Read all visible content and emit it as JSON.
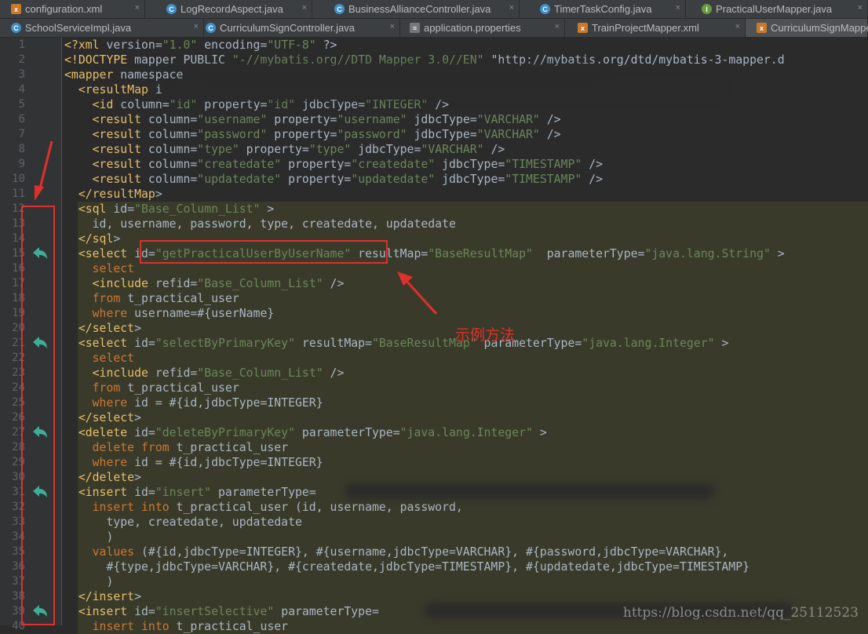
{
  "tabs_row1": [
    {
      "label": "configuration.xml",
      "icon": "xml-file-icon",
      "type": "x"
    },
    {
      "label": "LogRecordAspect.java",
      "icon": "class-icon",
      "type": "c"
    },
    {
      "label": "BusinessAllianceController.java",
      "icon": "class-icon",
      "type": "c"
    },
    {
      "label": "TimerTaskConfig.java",
      "icon": "class-icon",
      "type": "c"
    },
    {
      "label": "PracticalUserMapper.java",
      "icon": "interface-icon",
      "type": "i"
    }
  ],
  "tabs_row2": [
    {
      "label": "SchoolServiceImpl.java",
      "icon": "class-icon",
      "type": "c"
    },
    {
      "label": "CurriculumSignController.java",
      "icon": "class-icon",
      "type": "c"
    },
    {
      "label": "application.properties",
      "icon": "properties-file-icon",
      "type": "p"
    },
    {
      "label": "TrainProjectMapper.xml",
      "icon": "xml-file-icon",
      "type": "x"
    },
    {
      "label": "CurriculumSignMappe",
      "icon": "xml-file-icon",
      "type": "x"
    }
  ],
  "lines": [
    {
      "n": "1",
      "code": "<?xml version=\"1.0\" encoding=\"UTF-8\" ?>"
    },
    {
      "n": "2",
      "code": "<!DOCTYPE mapper PUBLIC \"-//mybatis.org//DTD Mapper 3.0//EN\" \"http://mybatis.org/dtd/mybatis-3-mapper.d"
    },
    {
      "n": "3",
      "code": "<mapper namespace"
    },
    {
      "n": "4",
      "code": "  <resultMap i"
    },
    {
      "n": "5",
      "code": "    <id column=\"id\" property=\"id\" jdbcType=\"INTEGER\" />"
    },
    {
      "n": "6",
      "code": "    <result column=\"username\" property=\"username\" jdbcType=\"VARCHAR\" />"
    },
    {
      "n": "7",
      "code": "    <result column=\"password\" property=\"password\" jdbcType=\"VARCHAR\" />"
    },
    {
      "n": "8",
      "code": "    <result column=\"type\" property=\"type\" jdbcType=\"VARCHAR\" />"
    },
    {
      "n": "9",
      "code": "    <result column=\"createdate\" property=\"createdate\" jdbcType=\"TIMESTAMP\" />"
    },
    {
      "n": "10",
      "code": "    <result column=\"updatedate\" property=\"updatedate\" jdbcType=\"TIMESTAMP\" />"
    },
    {
      "n": "11",
      "code": "  </resultMap>"
    },
    {
      "n": "12",
      "code": "  <sql id=\"Base_Column_List\" >"
    },
    {
      "n": "13",
      "code": "    id, username, password, type, createdate, updatedate"
    },
    {
      "n": "14",
      "code": "  </sql>"
    },
    {
      "n": "15",
      "code": "  <select id=\"getPracticalUserByUserName\" resultMap=\"BaseResultMap\"  parameterType=\"java.lang.String\" >"
    },
    {
      "n": "16",
      "code": "    select"
    },
    {
      "n": "17",
      "code": "    <include refid=\"Base_Column_List\" />"
    },
    {
      "n": "18",
      "code": "    from t_practical_user"
    },
    {
      "n": "19",
      "code": "    where username=#{userName}"
    },
    {
      "n": "20",
      "code": "  </select>"
    },
    {
      "n": "21",
      "code": "  <select id=\"selectByPrimaryKey\" resultMap=\"BaseResultMap\" parameterType=\"java.lang.Integer\" >"
    },
    {
      "n": "22",
      "code": "    select"
    },
    {
      "n": "23",
      "code": "    <include refid=\"Base_Column_List\" />"
    },
    {
      "n": "24",
      "code": "    from t_practical_user"
    },
    {
      "n": "25",
      "code": "    where id = #{id,jdbcType=INTEGER}"
    },
    {
      "n": "26",
      "code": "  </select>"
    },
    {
      "n": "27",
      "code": "  <delete id=\"deleteByPrimaryKey\" parameterType=\"java.lang.Integer\" >"
    },
    {
      "n": "28",
      "code": "    delete from t_practical_user"
    },
    {
      "n": "29",
      "code": "    where id = #{id,jdbcType=INTEGER}"
    },
    {
      "n": "30",
      "code": "  </delete>"
    },
    {
      "n": "31",
      "code": "  <insert id=\"insert\" parameterType="
    },
    {
      "n": "32",
      "code": "    insert into t_practical_user (id, username, password,"
    },
    {
      "n": "33",
      "code": "      type, createdate, updatedate"
    },
    {
      "n": "34",
      "code": "      )"
    },
    {
      "n": "35",
      "code": "    values (#{id,jdbcType=INTEGER}, #{username,jdbcType=VARCHAR}, #{password,jdbcType=VARCHAR},"
    },
    {
      "n": "36",
      "code": "      #{type,jdbcType=VARCHAR}, #{createdate,jdbcType=TIMESTAMP}, #{updatedate,jdbcType=TIMESTAMP}"
    },
    {
      "n": "37",
      "code": "      )"
    },
    {
      "n": "38",
      "code": "  </insert>"
    },
    {
      "n": "39",
      "code": "  <insert id=\"insertSelective\" parameterType="
    },
    {
      "n": "40",
      "code": "    insert into t_practical_user"
    }
  ],
  "annotation": "示例方法",
  "watermark": "https://blog.csdn.net/qq_25112523",
  "colors": {
    "annotation_red": "#e0302c",
    "tag": "#e8bf6a",
    "string": "#6a8759",
    "keyword": "#cc7832"
  }
}
